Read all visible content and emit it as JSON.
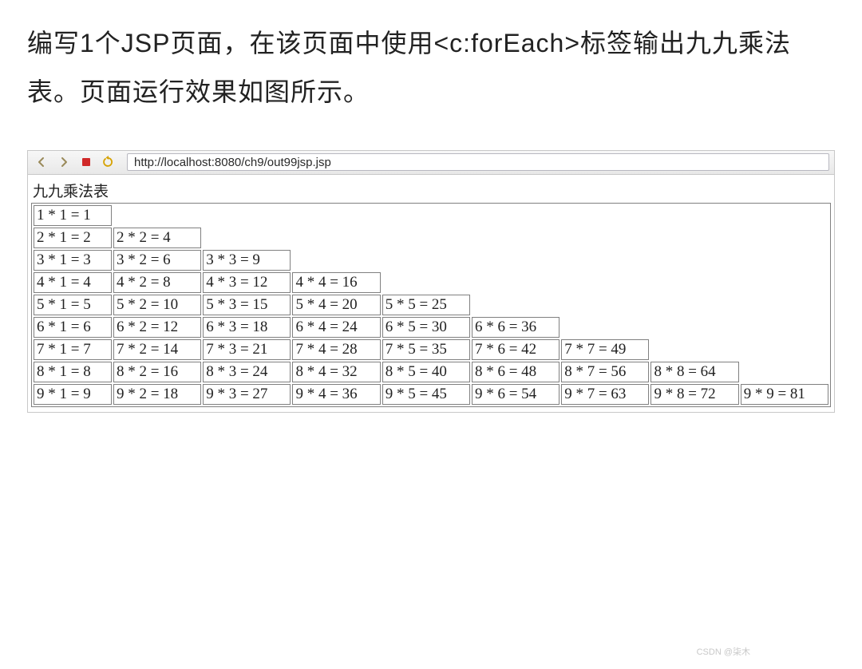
{
  "question_text": "编写1个JSP页面，在该页面中使用<c:forEach>标签输出九九乘法表。页面运行效果如图所示。",
  "browser": {
    "url": "http://localhost:8080/ch9/out99jsp.jsp"
  },
  "page": {
    "caption": "九九乘法表"
  },
  "chart_data": {
    "type": "table",
    "title": "九九乘法表",
    "rows": [
      [
        "1 * 1 = 1"
      ],
      [
        "2 * 1 = 2",
        "2 * 2 = 4"
      ],
      [
        "3 * 1 = 3",
        "3 * 2 = 6",
        "3 * 3 = 9"
      ],
      [
        "4 * 1 = 4",
        "4 * 2 = 8",
        "4 * 3 = 12",
        "4 * 4 = 16"
      ],
      [
        "5 * 1 = 5",
        "5 * 2 = 10",
        "5 * 3 = 15",
        "5 * 4 = 20",
        "5 * 5 = 25"
      ],
      [
        "6 * 1 = 6",
        "6 * 2 = 12",
        "6 * 3 = 18",
        "6 * 4 = 24",
        "6 * 5 = 30",
        "6 * 6 = 36"
      ],
      [
        "7 * 1 = 7",
        "7 * 2 = 14",
        "7 * 3 = 21",
        "7 * 4 = 28",
        "7 * 5 = 35",
        "7 * 6 = 42",
        "7 * 7 = 49"
      ],
      [
        "8 * 1 = 8",
        "8 * 2 = 16",
        "8 * 3 = 24",
        "8 * 4 = 32",
        "8 * 5 = 40",
        "8 * 6 = 48",
        "8 * 7 = 56",
        "8 * 8 = 64"
      ],
      [
        "9 * 1 = 9",
        "9 * 2 = 18",
        "9 * 3 = 27",
        "9 * 4 = 36",
        "9 * 5 = 45",
        "9 * 6 = 54",
        "9 * 7 = 63",
        "9 * 8 = 72",
        "9 * 9 = 81"
      ]
    ]
  },
  "watermark": "CSDN @柒木"
}
